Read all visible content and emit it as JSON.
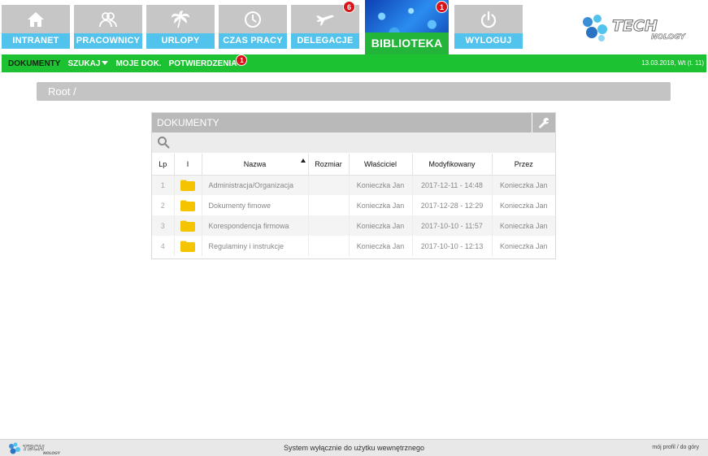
{
  "tabs": [
    {
      "label": "INTRANET",
      "icon": "home-icon"
    },
    {
      "label": "PRACOWNICY",
      "icon": "users-icon"
    },
    {
      "label": "URLOPY",
      "icon": "palm-tree-icon"
    },
    {
      "label": "CZAS PRACY",
      "icon": "clock-icon"
    },
    {
      "label": "DELEGACJE",
      "icon": "airplane-icon",
      "badge": "6"
    },
    {
      "label": "BIBLIOTEKA",
      "badge": "1",
      "active": true
    },
    {
      "label": "WYLOGUJ",
      "icon": "power-icon"
    }
  ],
  "logo": {
    "text": "TECH",
    "sub": "NOLOGY"
  },
  "submenu": {
    "items": [
      {
        "label": "DOKUMENTY",
        "active": true
      },
      {
        "label": "SZUKAJ"
      },
      {
        "label": "MOJE DOK."
      },
      {
        "label": "POTWIERDZENIA",
        "badge": "1"
      }
    ],
    "date": "13.03.2018, Wt (t. 11)"
  },
  "breadcrumb": "Root /",
  "panel": {
    "title": "DOKUMENTY",
    "columns": [
      "Lp",
      "I",
      "Nazwa",
      "Rozmiar",
      "Właściciel",
      "Modyfikowany",
      "Przez"
    ],
    "rows": [
      {
        "lp": "1",
        "name": "Administracja/Organizacja",
        "size": "",
        "owner": "Konieczka Jan",
        "modified": "2017-12-11 - 14:48",
        "by": "Konieczka Jan"
      },
      {
        "lp": "2",
        "name": "Dokumenty fimowe",
        "size": "",
        "owner": "Konieczka Jan",
        "modified": "2017-12-28 - 12:29",
        "by": "Konieczka Jan"
      },
      {
        "lp": "3",
        "name": "Korespondencja firmowa",
        "size": "",
        "owner": "Konieczka Jan",
        "modified": "2017-10-10 - 11:57",
        "by": "Konieczka Jan"
      },
      {
        "lp": "4",
        "name": "Regulaminy i instrukcje",
        "size": "",
        "owner": "Konieczka Jan",
        "modified": "2017-10-10 - 12:13",
        "by": "Konieczka Jan"
      }
    ]
  },
  "footer": {
    "text": "System wyłącznie do użytku wewnętrznego",
    "link_profile": "mój profil",
    "separator": "/",
    "link_top": "do góry"
  },
  "colors": {
    "accent_blue": "#52c3ec",
    "accent_green": "#1dc232",
    "badge_red": "#d8141a",
    "folder": "#f5c400"
  }
}
